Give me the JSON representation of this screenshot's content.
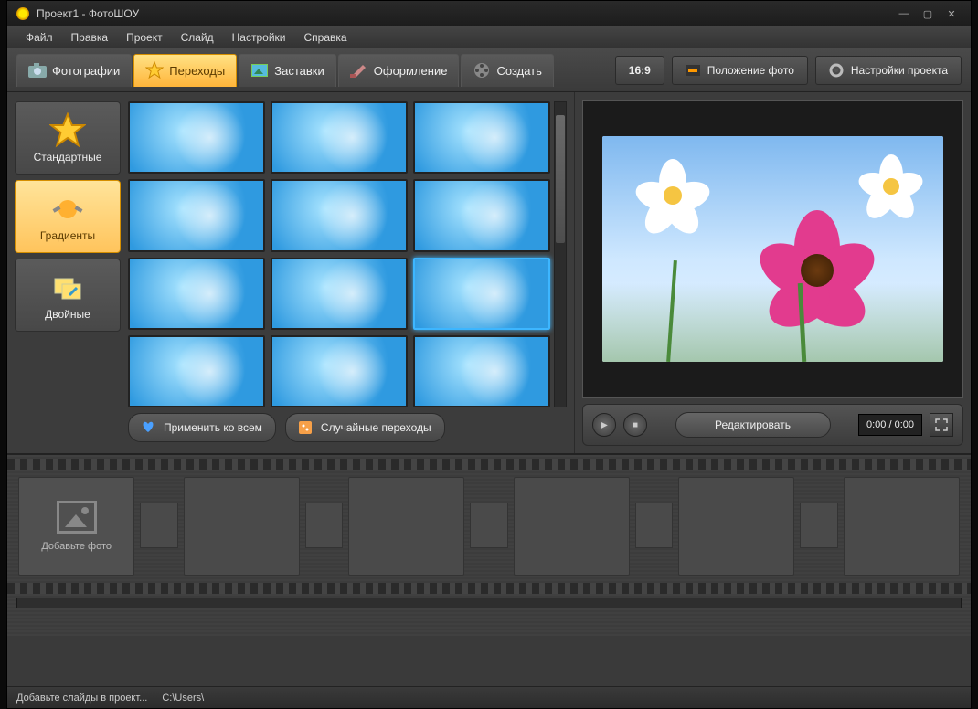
{
  "title": "Проект1 - ФотоШОУ",
  "menu": {
    "file": "Файл",
    "edit": "Правка",
    "project": "Проект",
    "slide": "Слайд",
    "settings": "Настройки",
    "help": "Справка"
  },
  "tabs": {
    "photos": "Фотографии",
    "transitions": "Переходы",
    "splash": "Заставки",
    "design": "Оформление",
    "create": "Создать"
  },
  "ratio": "16:9",
  "rtools": {
    "position": "Положение фото",
    "settings": "Настройки проекта"
  },
  "categories": {
    "standard": "Стандартные",
    "gradients": "Градиенты",
    "double": "Двойные"
  },
  "actions": {
    "applyAll": "Применить ко всем",
    "random": "Случайные переходы"
  },
  "preview": {
    "edit": "Редактировать",
    "time": "0:00 / 0:00"
  },
  "timeline": {
    "addPhoto": "Добавьте фото"
  },
  "status": {
    "hint": "Добавьте слайды в проект...",
    "path": "C:\\Users\\"
  }
}
